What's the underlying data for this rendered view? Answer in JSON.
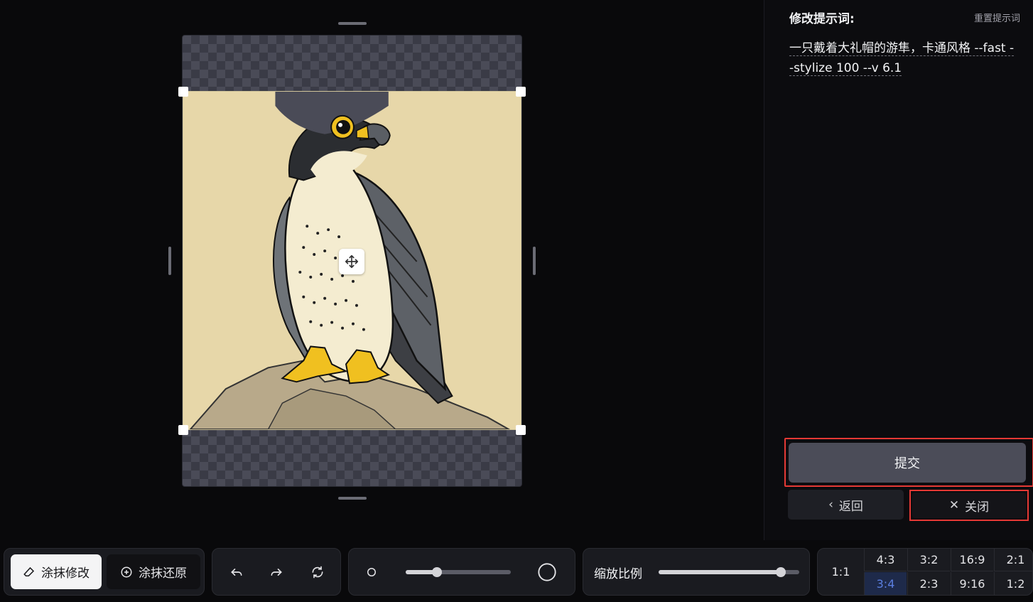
{
  "panel": {
    "title": "修改提示词:",
    "reset_label": "重置提示词",
    "prompt_line1": "一只戴着大礼帽的游隼，卡通风格 --fast -",
    "prompt_line2": "-stylize 100 --v 6.1",
    "submit_label": "提交",
    "back_label": "返回",
    "close_label": "关闭"
  },
  "toolbar": {
    "erase_modify_label": "涂抹修改",
    "erase_restore_label": "涂抹还原",
    "brush_size_level": 0.3,
    "zoom_label": "缩放比例",
    "zoom_level": 0.87,
    "ratio_main": "1:1",
    "ratios_top": [
      "4:3",
      "3:2",
      "16:9",
      "2:1"
    ],
    "ratios_bottom": [
      "3:4",
      "2:3",
      "9:16",
      "1:2"
    ],
    "selected_ratio": "3:4"
  },
  "colors": {
    "accent_red": "#e53935",
    "selected_blue": "#5b7fe0"
  }
}
